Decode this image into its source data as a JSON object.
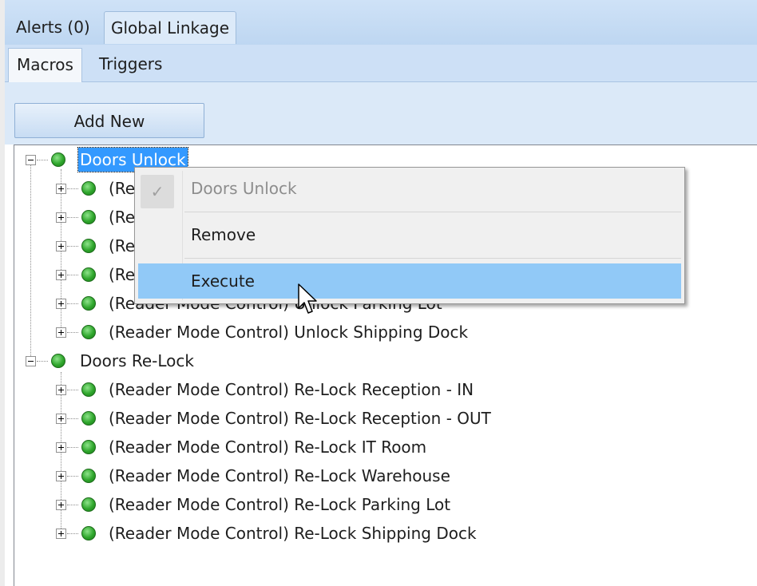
{
  "tabs_top": [
    {
      "label": "Alerts (0)",
      "active": false
    },
    {
      "label": "Global Linkage",
      "active": true
    }
  ],
  "tabs_sub": [
    {
      "label": "Macros",
      "active": true
    },
    {
      "label": "Triggers",
      "active": false
    }
  ],
  "toolbar": {
    "add_new_label": "Add New"
  },
  "tree": {
    "groups": [
      {
        "label": "Doors Unlock",
        "selected": true,
        "children": [
          {
            "label": "(Re"
          },
          {
            "label": "(Re"
          },
          {
            "label": "(Re"
          },
          {
            "label": "(Re"
          },
          {
            "label": "(Reader Mode Control) Unlock Parking Lot"
          },
          {
            "label": "(Reader Mode Control) Unlock Shipping Dock"
          }
        ]
      },
      {
        "label": "Doors Re-Lock",
        "selected": false,
        "children": [
          {
            "label": "(Reader Mode Control) Re-Lock Reception - IN"
          },
          {
            "label": "(Reader Mode Control) Re-Lock Reception - OUT"
          },
          {
            "label": "(Reader Mode Control) Re-Lock IT Room"
          },
          {
            "label": "(Reader Mode Control) Re-Lock Warehouse"
          },
          {
            "label": "(Reader Mode Control) Re-Lock Parking Lot"
          },
          {
            "label": "(Reader Mode Control) Re-Lock Shipping Dock"
          }
        ]
      }
    ]
  },
  "context_menu": {
    "items": [
      {
        "label": "Doors Unlock",
        "icon": "check-icon",
        "disabled": true
      },
      {
        "label": "Remove"
      },
      {
        "label": "Execute",
        "hovered": true
      }
    ]
  },
  "colors": {
    "selection": "#3399ff",
    "menu_hover": "#91c9f7",
    "status_green": "#2fa62c",
    "tab_bar": "#cde0f6"
  }
}
